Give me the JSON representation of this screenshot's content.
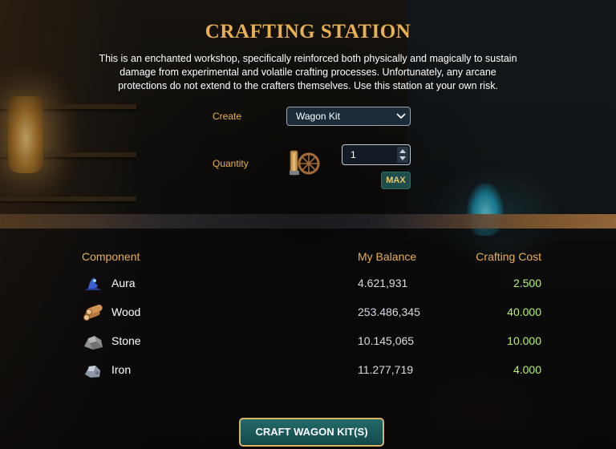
{
  "title": "CRAFTING STATION",
  "description": "This is an enchanted workshop, specifically reinforced both physically and magically to sustain damage from experimental and volatile crafting processes. Unfortunately, any arcane protections do not extend to the crafters themselves. Use this station at your own risk.",
  "form": {
    "create_label": "Create",
    "create_value": "Wagon Kit",
    "quantity_label": "Quantity",
    "quantity_value": "1",
    "max_label": "MAX"
  },
  "table": {
    "headers": [
      "Component",
      "My Balance",
      "Crafting Cost"
    ],
    "rows": [
      {
        "name": "Aura",
        "balance": "4.621,931",
        "cost": "2.500",
        "icon": "aura-icon"
      },
      {
        "name": "Wood",
        "balance": "253.486,345",
        "cost": "40.000",
        "icon": "wood-icon"
      },
      {
        "name": "Stone",
        "balance": "10.145,065",
        "cost": "10.000",
        "icon": "stone-icon"
      },
      {
        "name": "Iron",
        "balance": "11.277,719",
        "cost": "4.000",
        "icon": "iron-icon"
      }
    ]
  },
  "craft_button": "CRAFT WAGON KIT(S)",
  "colors": {
    "accent_gold": "#e8b052",
    "cost_green": "#b7f06a",
    "button_teal": "#1e5f5e"
  }
}
